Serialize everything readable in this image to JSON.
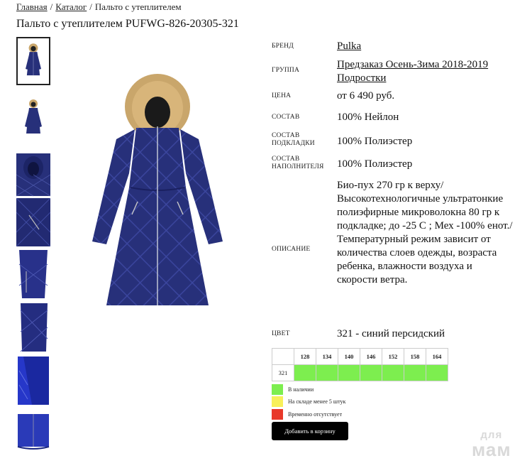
{
  "breadcrumb": {
    "home": "Главная",
    "catalog": "Каталог",
    "current": "Пальто с утеплителем",
    "separator": "/"
  },
  "product": {
    "title": "Пальто с утеплителем PUFWG-826-20305-321"
  },
  "details": {
    "brand": {
      "label": "БРЕНД",
      "value": "Pulka"
    },
    "group": {
      "label": "ГРУППА",
      "value_line1": "Предзаказ Осень-Зима 2018-2019",
      "value_line2": "Подростки"
    },
    "price": {
      "label": "ЦЕНА",
      "value": "от 6 490 руб."
    },
    "composition": {
      "label": "СОСТАВ",
      "value": "100% Нейлон"
    },
    "lining": {
      "label_line1": "СОСТАВ",
      "label_line2": "ПОДКЛАДКИ",
      "value": "100% Полиэстер"
    },
    "filler": {
      "label_line1": "СОСТАВ",
      "label_line2": "НАПОЛНИТЕЛЯ",
      "value": "100% Полиэстер"
    },
    "description": {
      "label": "ОПИСАНИЕ",
      "lines": [
        "Био-пух 270 гр к верху/",
        "Высокотехнологичные ультратонкие",
        "полиэфирные микроволокна 80 гр к",
        "подкладке; до -25 С ; Мех -100% енот./",
        "Температурный режим зависит от",
        "количества слоев одежды, возраста",
        "ребенка, влажности воздуха и",
        "скорости ветра."
      ]
    },
    "color": {
      "label": "ЦВЕТ",
      "value": "321 - синий персидский"
    }
  },
  "sizes": {
    "headers": [
      "128",
      "134",
      "140",
      "146",
      "152",
      "158",
      "164"
    ],
    "row_label": "321",
    "availability_color": "#7dee4f"
  },
  "legend": [
    {
      "color": "#7dee4f",
      "text": "В наличии"
    },
    {
      "color": "#f8f05a",
      "text": "На складе менее 5 штук"
    },
    {
      "color": "#e8392a",
      "text": "Временно отсутствует"
    }
  ],
  "cart_button": {
    "label": "Добавить в корзину"
  },
  "watermark": {
    "line1": "для",
    "line2": "мам"
  },
  "colors": {
    "coat": "#27307a",
    "fur": "#c9a66b"
  },
  "images": {
    "main": "coat-front-icon",
    "thumbs": [
      "coat-front-icon",
      "coat-front-icon",
      "coat-hood-icon",
      "coat-pocket-icon",
      "coat-side-icon",
      "coat-detail-icon",
      "coat-lining-icon",
      "coat-hem-icon"
    ]
  }
}
